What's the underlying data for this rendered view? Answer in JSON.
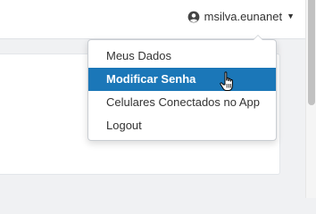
{
  "header": {
    "user_name": "msilva.eunanet",
    "user_icon": "user-circle-icon",
    "caret_icon": "caret-down-icon"
  },
  "dropdown": {
    "items": [
      {
        "label": "Meus Dados",
        "active": false
      },
      {
        "label": "Modificar Senha",
        "active": true
      },
      {
        "label": "Celulares Conectados no App",
        "active": false
      },
      {
        "label": "Logout",
        "active": false
      }
    ]
  },
  "colors": {
    "active_item_bg": "#1b77b8",
    "active_item_text": "#ffffff",
    "page_bg": "#f0f1f3"
  },
  "cursor": "hand-pointer-icon"
}
